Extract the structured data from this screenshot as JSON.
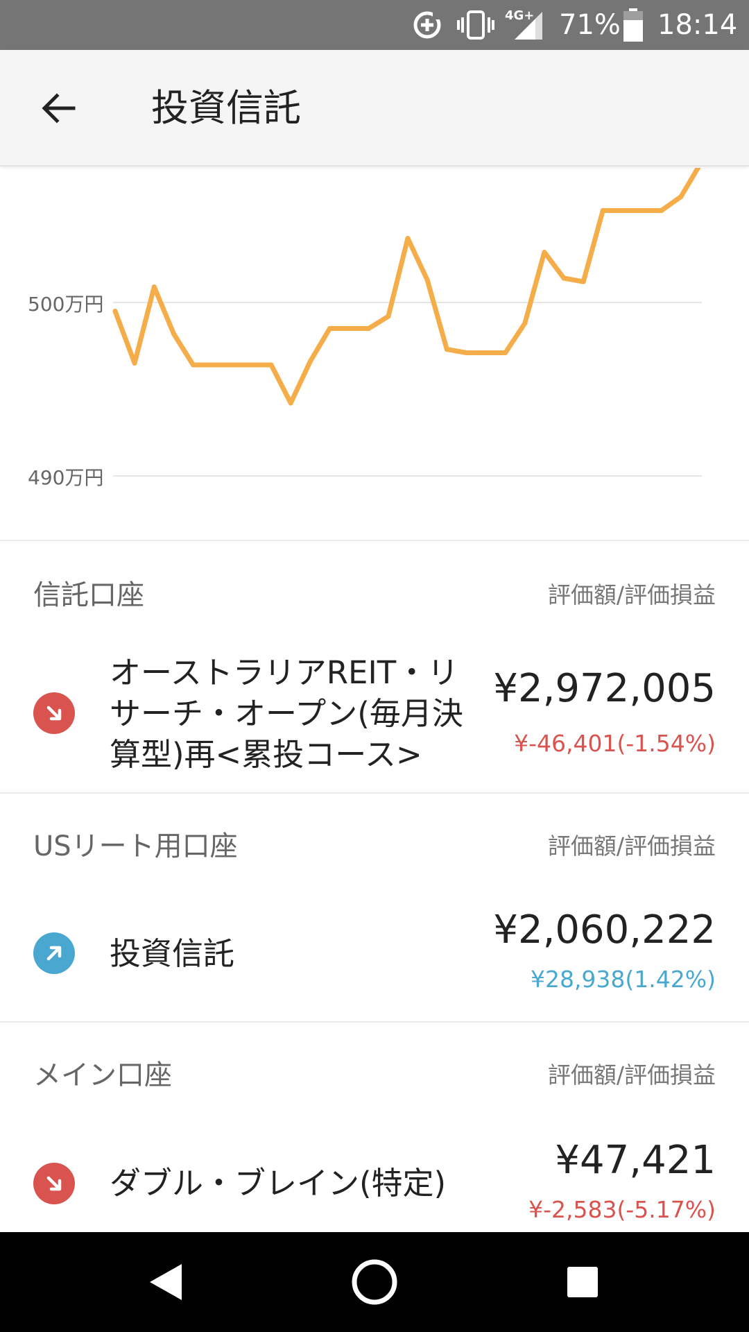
{
  "status_bar": {
    "network": "4G+",
    "battery": "71%",
    "time": "18:14",
    "icons": [
      "data-saver-icon",
      "vibrate-icon",
      "signal-icon",
      "battery-icon"
    ]
  },
  "app_bar": {
    "title": "投資信託",
    "back_icon": "arrow-back-icon"
  },
  "chart_data": {
    "type": "line",
    "y_ticks": [
      "500万円",
      "490万円"
    ],
    "ylim": [
      490,
      500
    ],
    "grid": true,
    "color": "#f5ad4a",
    "values": [
      499.5,
      496.5,
      500.9,
      498.2,
      496.4,
      496.4,
      496.4,
      496.4,
      496.4,
      494.2,
      496.6,
      498.5,
      498.5,
      498.5,
      499.2,
      503.7,
      501.3,
      497.3,
      497.1,
      497.1,
      497.1,
      498.8,
      502.9,
      501.4,
      501.2,
      505.3,
      505.3,
      505.3,
      505.3,
      506.1,
      508.0
    ]
  },
  "sections": [
    {
      "title": "信託口座",
      "column_label": "評価額/評価損益",
      "funds": [
        {
          "name_lines": [
            "オーストラリアREIT・リ",
            "サーチ・オープン(毎月決",
            "算型)再<累投コース>"
          ],
          "value": "¥2,972,005",
          "change": "¥-46,401(-1.54%)",
          "trend": "down",
          "trend_icon": "arrow-down-right-icon"
        }
      ]
    },
    {
      "title": "USリート用口座",
      "column_label": "評価額/評価損益",
      "funds": [
        {
          "name_lines": [
            "投資信託"
          ],
          "value": "¥2,060,222",
          "change": "¥28,938(1.42%)",
          "trend": "up",
          "trend_icon": "arrow-up-right-icon"
        }
      ]
    },
    {
      "title": "メイン口座",
      "column_label": "評価額/評価損益",
      "funds": [
        {
          "name_lines": [
            "ダブル・ブレイン(特定)"
          ],
          "value": "¥47,421",
          "change": "¥-2,583(-5.17%)",
          "trend": "down",
          "trend_icon": "arrow-down-right-icon"
        }
      ]
    }
  ],
  "colors": {
    "negative": "#d9534f",
    "positive": "#4aa8d0",
    "chart_line": "#f5ad4a"
  },
  "nav_bar": {
    "icons": [
      "nav-back-icon",
      "nav-home-icon",
      "nav-recents-icon"
    ]
  }
}
